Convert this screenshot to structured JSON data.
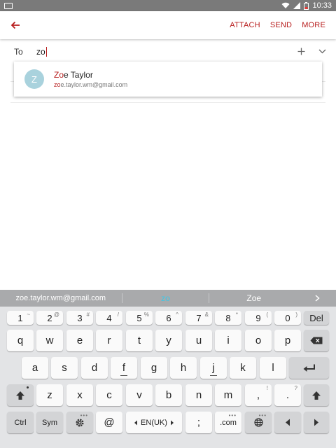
{
  "status_bar": {
    "time": "10:33",
    "icons": [
      "notification-icon",
      "wifi-icon",
      "signal-icon",
      "battery-low-icon"
    ]
  },
  "app_bar": {
    "back_icon": "arrow-left-icon",
    "attach_label": "ATTACH",
    "send_label": "SEND",
    "more_label": "MORE",
    "accent_color": "#b71c1c"
  },
  "compose": {
    "to_label": "To",
    "to_value": "zo"
  },
  "suggestion": {
    "avatar_letter": "Z",
    "name_match": "Zo",
    "name_rest": "e Taylor",
    "email_match": "zo",
    "email_rest": "e.taylor.wm@gmail.com"
  },
  "keyboard": {
    "predictions": [
      "zoe.taylor.wm@gmail.com",
      "zo",
      "Zoe"
    ],
    "number_row": [
      {
        "main": "1",
        "hint": "~"
      },
      {
        "main": "2",
        "hint": "@"
      },
      {
        "main": "3",
        "hint": "#"
      },
      {
        "main": "4",
        "hint": "/"
      },
      {
        "main": "5",
        "hint": "%"
      },
      {
        "main": "6",
        "hint": "^"
      },
      {
        "main": "7",
        "hint": "&"
      },
      {
        "main": "8",
        "hint": "*"
      },
      {
        "main": "9",
        "hint": "("
      },
      {
        "main": "0",
        "hint": ")"
      }
    ],
    "del_label": "Del",
    "row1": [
      "q",
      "w",
      "e",
      "r",
      "t",
      "y",
      "u",
      "i",
      "o",
      "p"
    ],
    "row2": [
      "a",
      "s",
      "d",
      "f",
      "g",
      "h",
      "j",
      "k",
      "l"
    ],
    "row3": [
      "z",
      "x",
      "c",
      "v",
      "b",
      "n",
      "m",
      ",",
      "."
    ],
    "row3_hints": {
      ",": "!",
      ".": "?"
    },
    "ctrl_label": "Ctrl",
    "sym_label": "Sym",
    "at_label": "@",
    "lang_label": "EN(UK)",
    "semicolon_label": ";",
    "dotcom_label": ".com"
  }
}
